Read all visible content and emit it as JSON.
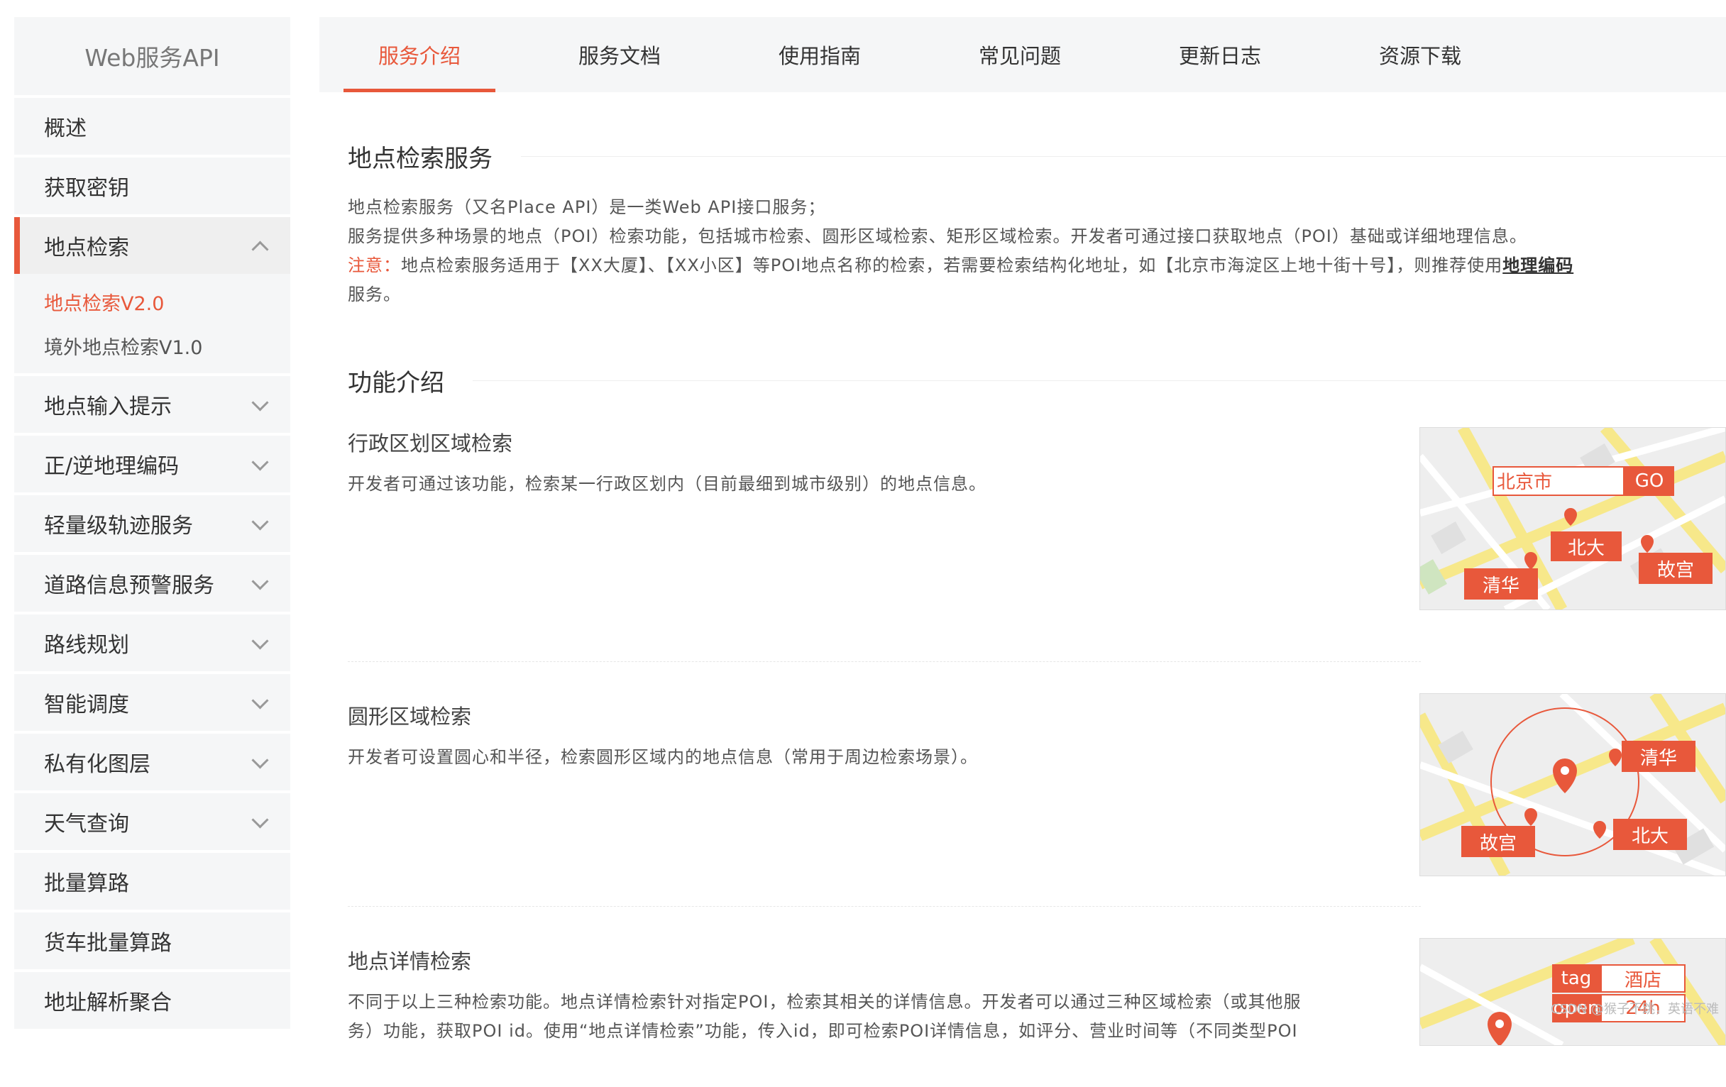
{
  "sidebar": {
    "brand": "Web服务API",
    "items": [
      {
        "label": "概述"
      },
      {
        "label": "获取密钥"
      },
      {
        "label": "地点检索"
      },
      {
        "label": "地点输入提示"
      },
      {
        "label": "正/逆地理编码"
      },
      {
        "label": "轻量级轨迹服务"
      },
      {
        "label": "道路信息预警服务"
      },
      {
        "label": "路线规划"
      },
      {
        "label": "智能调度"
      },
      {
        "label": "私有化图层"
      },
      {
        "label": "天气查询"
      },
      {
        "label": "批量算路"
      },
      {
        "label": "货车批量算路"
      },
      {
        "label": "地址解析聚合"
      }
    ],
    "sub_items": [
      {
        "label": "地点检索V2.0"
      },
      {
        "label": "境外地点检索V1.0"
      }
    ]
  },
  "tabs": [
    {
      "label": "服务介绍"
    },
    {
      "label": "服务文档"
    },
    {
      "label": "使用指南"
    },
    {
      "label": "常见问题"
    },
    {
      "label": "更新日志"
    },
    {
      "label": "资源下载"
    }
  ],
  "intro": {
    "title": "地点检索服务",
    "line1": "地点检索服务（又名Place API）是一类Web API接口服务；",
    "line2": "服务提供多种场景的地点（POI）检索功能，包括城市检索、圆形区域检索、矩形区域检索。开发者可通过接口获取地点（POI）基础或详细地理信息。",
    "note_label": "注意：",
    "note_text": "地点检索服务适用于【XX大厦】、【XX小区】等POI地点名称的检索，若需要检索结构化地址，如【北京市海淀区上地十街十号】，则推荐使用",
    "note_link": "地理编码",
    "note_end": "服务。"
  },
  "features": {
    "title": "功能介绍",
    "items": [
      {
        "title": "行政区划区域检索",
        "desc": "开发者可通过该功能，检索某一行政区划内（目前最细到城市级别）的地点信息。"
      },
      {
        "title": "圆形区域检索",
        "desc": "开发者可设置圆心和半径，检索圆形区域内的地点信息（常用于周边检索场景）。"
      },
      {
        "title": "地点详情检索",
        "desc1": "不同于以上三种检索功能。地点详情检索针对指定POI，检索其相关的详情信息。开发者可以通过三种区域检索（或其他服",
        "desc2": "务）功能，获取POI id。使用“地点详情检索”功能，传入id，即可检索POI详情信息，如评分、营业时间等（不同类型POI"
      }
    ]
  },
  "map1": {
    "search": "北京市",
    "go": "GO",
    "l1": "北大",
    "l2": "故宫",
    "l3": "清华"
  },
  "map2": {
    "l1": "清华",
    "l2": "北大",
    "l3": "故宫"
  },
  "map3": {
    "tag": "tag",
    "tag_val": "酒店",
    "open": "open",
    "open_val": "24h"
  },
  "watermark": "CSDN @猴子不跳，英语不难",
  "colors": {
    "accent": "#e8583b",
    "sidebar_bg": "#f5f6f7"
  }
}
